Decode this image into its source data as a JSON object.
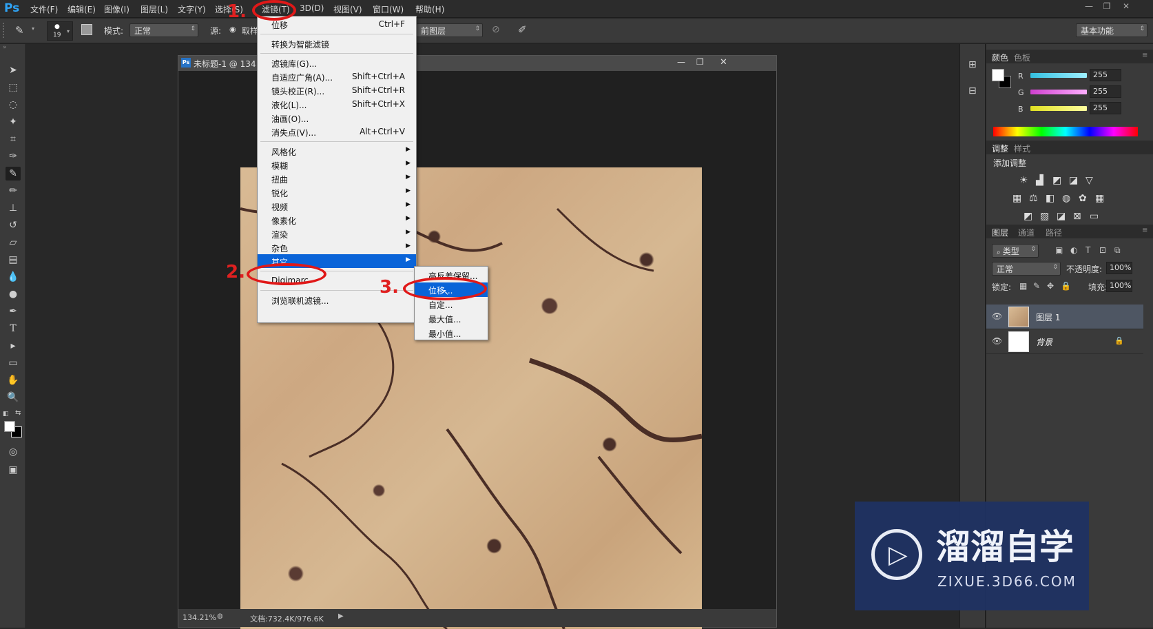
{
  "app": {
    "logo": "Ps"
  },
  "menubar": {
    "items": [
      "文件(F)",
      "编辑(E)",
      "图像(I)",
      "图层(L)",
      "文字(Y)",
      "选择(S)",
      "滤镜(T)",
      "3D(D)",
      "视图(V)",
      "窗口(W)",
      "帮助(H)"
    ],
    "window_controls": [
      "—",
      "❐",
      "✕"
    ]
  },
  "optionsbar": {
    "brush_size": "19",
    "mode_label": "模式:",
    "mode_value": "正常",
    "source_label": "源:",
    "sample_label": "取样",
    "sample_layer_value": "前图层",
    "workspace": "基本功能"
  },
  "document": {
    "title": "未标题-1 @ 134",
    "zoom": "134.21%",
    "doc_info": "文档:732.4K/976.6K"
  },
  "filter_menu": {
    "items": [
      {
        "label": "位移",
        "shortcut": "Ctrl+F"
      },
      {
        "label": "转换为智能滤镜",
        "shortcut": ""
      },
      {
        "label": "滤镜库(G)...",
        "shortcut": ""
      },
      {
        "label": "自适应广角(A)...",
        "shortcut": "Shift+Ctrl+A"
      },
      {
        "label": "镜头校正(R)...",
        "shortcut": "Shift+Ctrl+R"
      },
      {
        "label": "液化(L)...",
        "shortcut": "Shift+Ctrl+X"
      },
      {
        "label": "油画(O)...",
        "shortcut": ""
      },
      {
        "label": "消失点(V)...",
        "shortcut": "Alt+Ctrl+V"
      },
      {
        "label": "风格化",
        "shortcut": ""
      },
      {
        "label": "模糊",
        "shortcut": ""
      },
      {
        "label": "扭曲",
        "shortcut": ""
      },
      {
        "label": "锐化",
        "shortcut": ""
      },
      {
        "label": "视频",
        "shortcut": ""
      },
      {
        "label": "像素化",
        "shortcut": ""
      },
      {
        "label": "渲染",
        "shortcut": ""
      },
      {
        "label": "杂色",
        "shortcut": ""
      },
      {
        "label": "其它",
        "shortcut": ""
      },
      {
        "label": "Digimarc",
        "shortcut": ""
      },
      {
        "label": "浏览联机滤镜...",
        "shortcut": ""
      }
    ]
  },
  "submenu": {
    "items": [
      "高反差保留...",
      "位移...",
      "自定...",
      "最大值...",
      "最小值..."
    ]
  },
  "color_panel": {
    "tabs": [
      "颜色",
      "色板"
    ],
    "channels": [
      {
        "name": "R",
        "value": "255",
        "color": "#36c8e8"
      },
      {
        "name": "G",
        "value": "255",
        "color": "#d848d8"
      },
      {
        "name": "B",
        "value": "255",
        "color": "#e8e830"
      }
    ]
  },
  "adjust_panel": {
    "tabs": [
      "调整",
      "样式"
    ],
    "title": "添加调整"
  },
  "layers_panel": {
    "tabs": [
      "图层",
      "通道",
      "路径"
    ],
    "filter_kind": "类型",
    "blend_mode": "正常",
    "opacity_label": "不透明度:",
    "opacity_value": "100%",
    "lock_label": "锁定:",
    "fill_label": "填充:",
    "fill_value": "100%",
    "layers": [
      {
        "name": "图层 1",
        "selected": true
      },
      {
        "name": "背景",
        "selected": false
      }
    ]
  },
  "annotations": [
    "1.",
    "2.",
    "3."
  ],
  "watermark": {
    "title": "溜溜自学",
    "url": "ZIXUE.3D66.COM"
  },
  "colors": {
    "accent": "#0a64d8",
    "annotation": "#e01818",
    "ps_blue": "#2fa3f4"
  }
}
